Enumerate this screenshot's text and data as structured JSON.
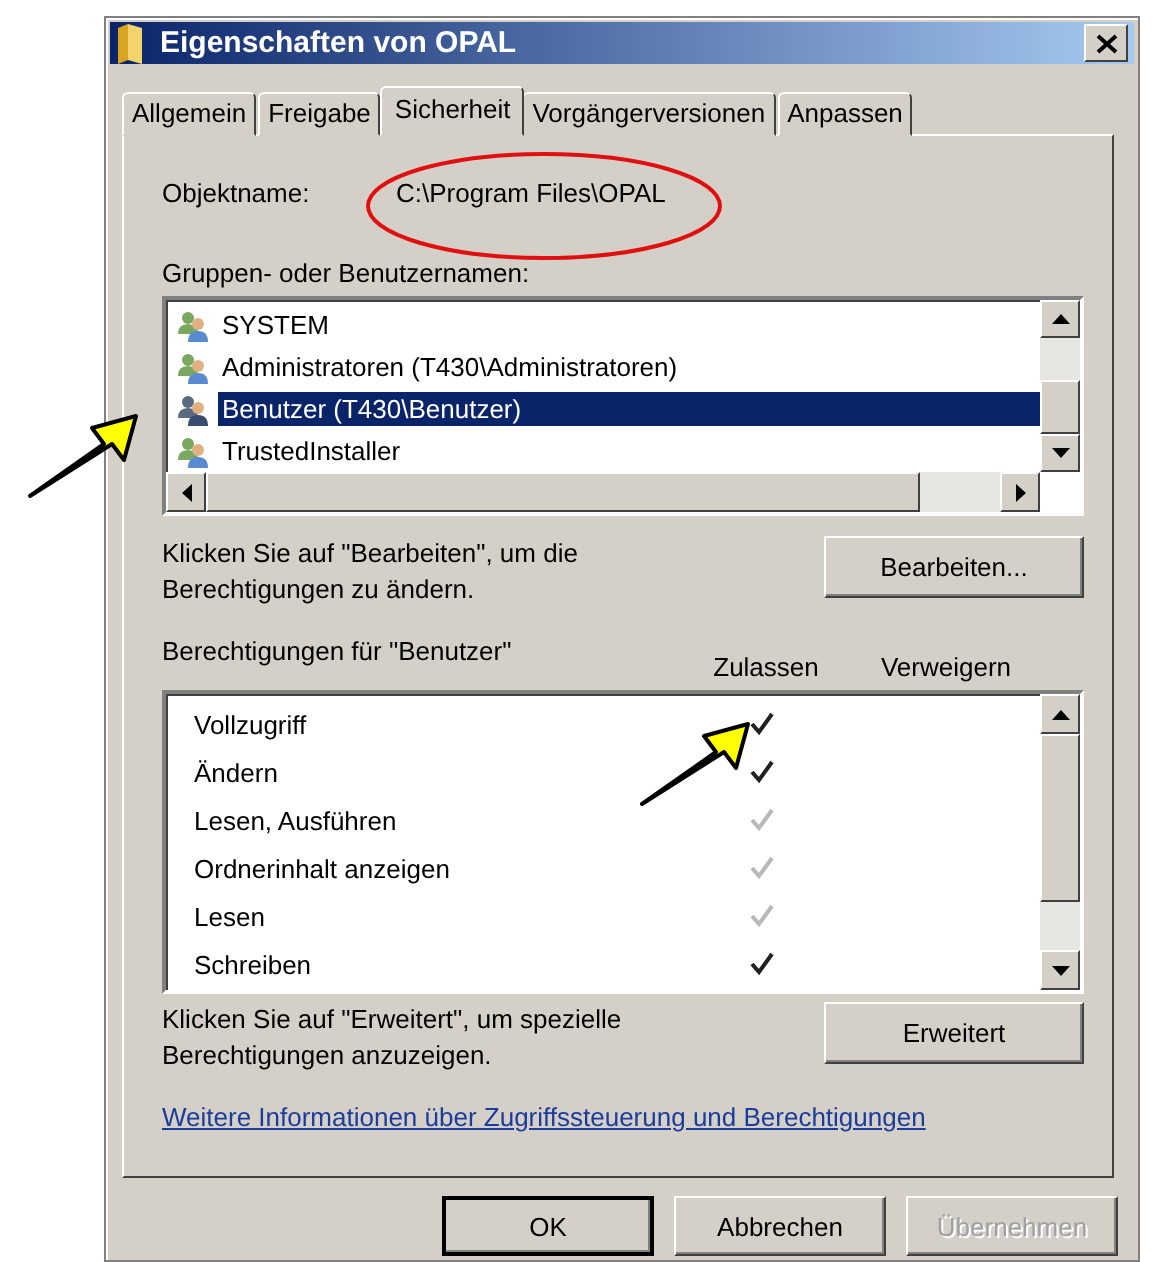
{
  "window": {
    "title": "Eigenschaften von OPAL"
  },
  "tabs": [
    {
      "label": "Allgemein",
      "selected": false
    },
    {
      "label": "Freigabe",
      "selected": false
    },
    {
      "label": "Sicherheit",
      "selected": true
    },
    {
      "label": "Vorgängerversionen",
      "selected": false
    },
    {
      "label": "Anpassen",
      "selected": false
    }
  ],
  "object_name": {
    "label": "Objektname:",
    "value": "C:\\Program Files\\OPAL"
  },
  "groups": {
    "label": "Gruppen- oder Benutzernamen:",
    "items": [
      {
        "name": "SYSTEM",
        "selected": false
      },
      {
        "name": "Administratoren (T430\\Administratoren)",
        "selected": false
      },
      {
        "name": "Benutzer (T430\\Benutzer)",
        "selected": true
      },
      {
        "name": "TrustedInstaller",
        "selected": false
      }
    ]
  },
  "edit_hint": "Klicken Sie auf \"Bearbeiten\", um die Berechtigungen zu ändern.",
  "edit_button": "Bearbeiten...",
  "permissions": {
    "label": "Berechtigungen für \"Benutzer\"",
    "columns": [
      "Zulassen",
      "Verweigern"
    ],
    "rows": [
      {
        "name": "Vollzugriff",
        "allow": true,
        "inherited": false,
        "deny": false
      },
      {
        "name": "Ändern",
        "allow": true,
        "inherited": false,
        "deny": false
      },
      {
        "name": "Lesen, Ausführen",
        "allow": true,
        "inherited": true,
        "deny": false
      },
      {
        "name": "Ordnerinhalt anzeigen",
        "allow": true,
        "inherited": true,
        "deny": false
      },
      {
        "name": "Lesen",
        "allow": true,
        "inherited": true,
        "deny": false
      },
      {
        "name": "Schreiben",
        "allow": true,
        "inherited": false,
        "deny": false
      }
    ]
  },
  "advanced_hint": "Klicken Sie auf \"Erweitert\", um spezielle Berechtigungen anzuzeigen.",
  "advanced_button": "Erweitert",
  "link": "Weitere Informationen über Zugriffssteuerung und Berechtigungen",
  "buttons": [
    {
      "label": "OK",
      "default": true,
      "disabled": false
    },
    {
      "label": "Abbrechen",
      "default": false,
      "disabled": false
    },
    {
      "label": "Übernehmen",
      "default": false,
      "disabled": true
    }
  ]
}
